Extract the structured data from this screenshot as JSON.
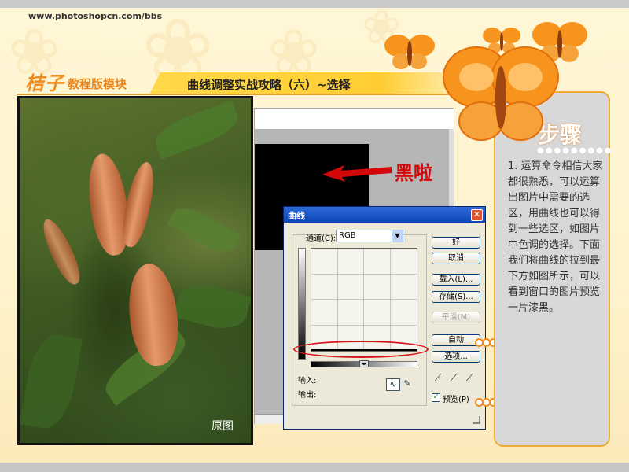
{
  "header": {
    "url": "www.photoshopcn.com/bbs",
    "brand": "桔子",
    "brand_sub": "教程版模块",
    "title": "曲线调整实战攻略（六）~选择"
  },
  "photo": {
    "caption": "原图"
  },
  "annotation": {
    "label": "黑啦"
  },
  "curves_dialog": {
    "title": "曲线",
    "close": "✕",
    "channel_label": "通道(C):",
    "channel_value": "RGB",
    "input_label": "输入:",
    "output_label": "输出:",
    "buttons": {
      "ok": "好",
      "cancel": "取消",
      "load": "载入(L)...",
      "save": "存储(S)...",
      "smooth": "平滑(M)",
      "auto": "自动",
      "options": "选项..."
    },
    "preview_label": "预览(P)",
    "preview_checked": "✓"
  },
  "steps": {
    "title": "步骤",
    "dots": "●●●●●●●●●",
    "text": "1. 运算命令相信大家都很熟悉，可以运算出图片中需要的选区，用曲线也可以得到一些选区，如图片中色调的选择。下面我们将曲线的拉到最下方如图所示，可以看到窗口的图片预览一片漆黑。"
  },
  "icons": {
    "dropdown": "chevron-down-icon",
    "curve_tool": "curve-tool-icon",
    "pencil_tool": "pencil-icon",
    "eyedropper": "eyedropper-icon"
  },
  "colors": {
    "accent_orange": "#f08a1c",
    "annotation_red": "#d2080b",
    "xp_blue": "#0c45b5"
  }
}
